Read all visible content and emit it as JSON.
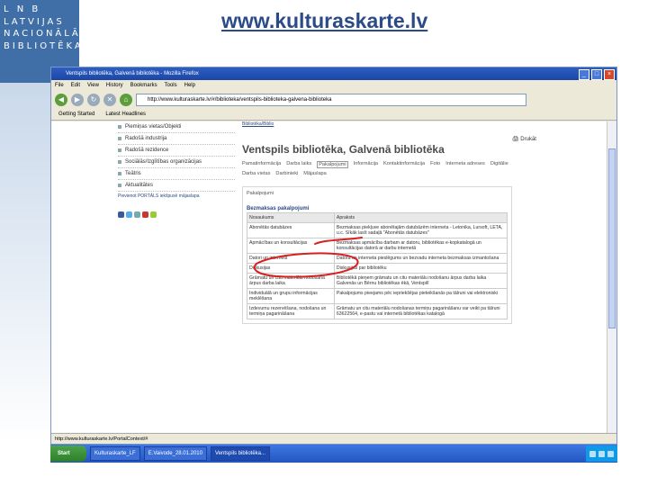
{
  "logo": {
    "lines": [
      "L N B",
      "LATVIJAS",
      "NACIONĀLĀ",
      "BIBLIOTĒKA"
    ]
  },
  "site_url": "www.kulturaskarte.lv",
  "browser": {
    "title": "Ventspils bibliotēka, Galvenā bibliotēka - Mozilla Firefox",
    "menu": [
      "File",
      "Edit",
      "View",
      "History",
      "Bookmarks",
      "Tools",
      "Help"
    ],
    "address": "http://www.kulturaskarte.lv/#/biblioteka/ventspils-biblioteka-galvena-biblioteka",
    "bookmarks": [
      "Getting Started",
      "Latest Headlines"
    ],
    "status": "http://www.kulturaskarte.lv/PortalContext/#"
  },
  "sidenav": {
    "items": [
      "Piemiņas vietas/Objekti",
      "Radošā industrija",
      "Radošā rezidence",
      "Sociālās/Izglītības organizācijas",
      "Teātris",
      "Aktualitātes"
    ],
    "note": "Pievienot PORTĀLS iekšpusē mājaslapa"
  },
  "page": {
    "breadcrumb": "Bibliotēka/Biblio",
    "title": "Ventspils bibliotēka, Galvenā bibliotēka",
    "print": "Drukāt",
    "tabs": [
      "Pamatinformācija",
      "Darba laiks",
      "Pakalpojumi",
      "Informācija",
      "Kontaktinformācija",
      "Foto",
      "Interneta adreses",
      "Digitālie",
      "Darba vietas",
      "Darbinieki",
      "Mājaslapa"
    ],
    "active_tab_index": 2,
    "panel_title": "Pakalpojumi",
    "table_caption": "Bezmaksas pakalpojumi",
    "columns": [
      "Nosaukums",
      "Apraksts"
    ],
    "rows": [
      [
        "Abonētās datubāzes",
        "Bezmaksas piekļuve abonētajām datubāzēm interneta - Letonika, Lursoft, LETA, u.c. Sīkāk lasīt sadaļā \"Abonētās datubāzes\""
      ],
      [
        "Apmācības un konsultācijas",
        "Bezmaksas apmācība darbam ar datoru, bibliotēkas e-kopkatalogā un konsultācijas datorā ar darbu internetā"
      ],
      [
        "Datori un internets",
        "Datora un interneta pieslēgums un bezvadu interneta bezmaksas izmantošana"
      ],
      [
        "Diskusijas",
        "Diskusijas par bibliotēku"
      ],
      [
        "Grāmatu un citu materiālu nodošana ārpus darba laika",
        "Bibliotēkā pieņem grāmatu un citu materiālu nodošanu ārpus darba laika Galvenās un Bērnu bibliotēkas ēkā, Ventspilī"
      ],
      [
        "Individuālā un grupu informācijas meklēšana",
        "Pakalpojums pieejams pēc iepriekšējas pieteikšanās pa tālruni vai elektroniski"
      ],
      [
        "Izdevumu rezervēšana, nodošana un termiņa pagarināšana",
        "Grāmatu un citu materiālu nodošanas termiņu pagarināšanu var veikt pa tālruni 63622564, e-pastu vai internetā bibliotēkas katalogā"
      ]
    ]
  },
  "taskbar": {
    "start": "Start",
    "tasks": [
      "Kulturaskarte_LF",
      "E.Vaivode_28.01.2010",
      "Ventspils bibliotēka..."
    ],
    "active_task_index": 2
  },
  "colors": {
    "logo_bg": "#3f6fa6",
    "url_text": "#2a4b88",
    "annotation": "#d82020",
    "taskbar": "#2455c0"
  }
}
